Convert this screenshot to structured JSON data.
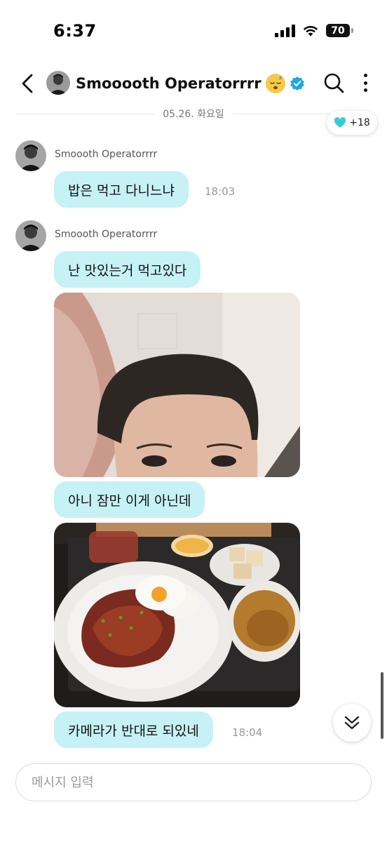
{
  "status_bar": {
    "time": "6:37",
    "battery": "70"
  },
  "header": {
    "title": "Smooooth Operatorrrr",
    "emoji_icon": "sleeping-face-icon",
    "verified_icon": "verified-badge-icon",
    "accent": "#1ea7e0"
  },
  "date_separator": "05.26. 화요일",
  "reaction": {
    "icon": "heart-icon",
    "count": "+18",
    "color": "#3cc9d6"
  },
  "messages": [
    {
      "sender": "Smoooth Operatorrrr",
      "text": "밥은 먹고 다니느냐",
      "time": "18:03"
    },
    {
      "sender": "Smoooth Operatorrrr",
      "text": "난 맛있는거 먹고있다"
    },
    {
      "text": "아니 잠만 이게 아닌데"
    },
    {
      "text": "카메라가 반대로 되있네",
      "time": "18:04"
    }
  ],
  "bubble_color": "#c6f1f5",
  "input": {
    "placeholder": "메시지 입력"
  }
}
